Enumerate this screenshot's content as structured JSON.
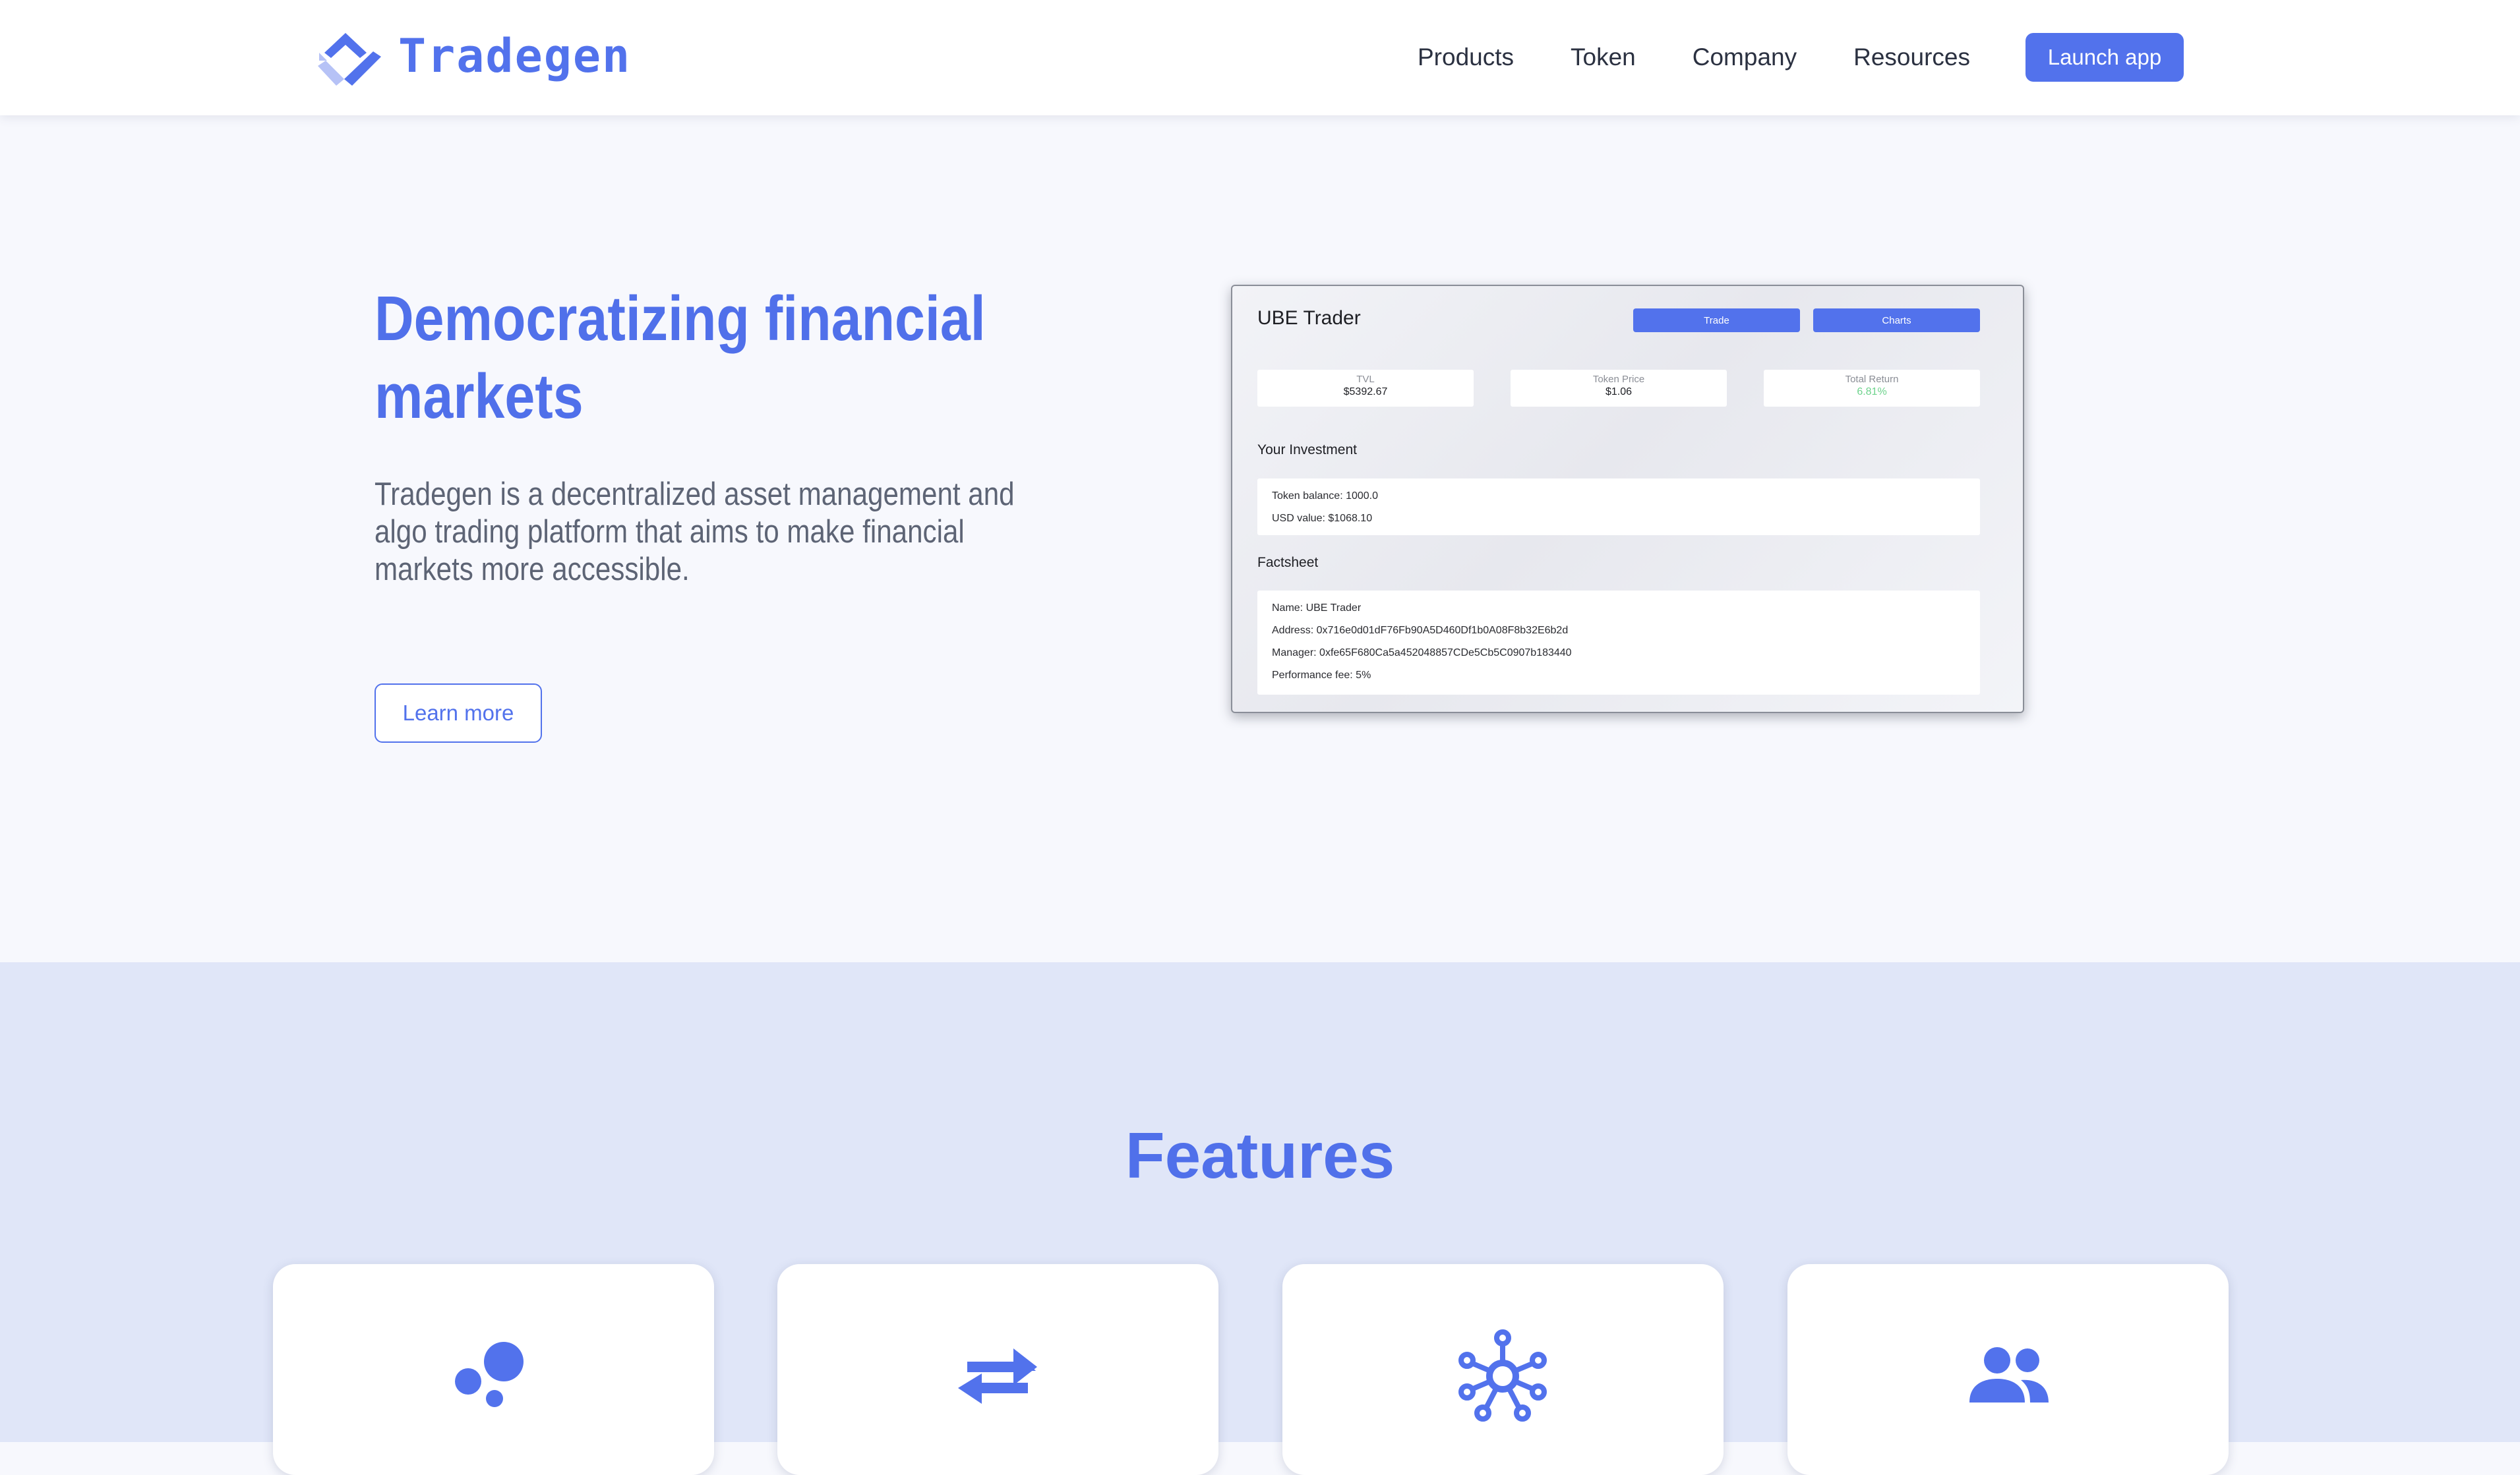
{
  "header": {
    "logo_text": "Tradegen",
    "nav": [
      "Products",
      "Token",
      "Company",
      "Resources"
    ],
    "launch_label": "Launch app"
  },
  "hero": {
    "title_line1": "Democratizing financial",
    "title_line2": "markets",
    "description": "Tradegen is a decentralized asset management and algo trading platform that aims to make financial markets more accessible.",
    "cta_label": "Learn more"
  },
  "app_preview": {
    "title": "UBE Trader",
    "buttons": [
      "Trade",
      "Charts"
    ],
    "stats": [
      {
        "label": "TVL",
        "value": "$5392.67"
      },
      {
        "label": "Token Price",
        "value": "$1.06"
      },
      {
        "label": "Total Return",
        "value": "6.81%"
      }
    ],
    "investment_heading": "Your Investment",
    "investment_lines": [
      "Token balance: 1000.0",
      "USD value: $1068.10"
    ],
    "factsheet_heading": "Factsheet",
    "factsheet_lines": [
      "Name: UBE Trader",
      "Address: 0x716e0d01dF76Fb90A5D460Df1b0A08F8b32E6b2d",
      "Manager: 0xfe65F680Ca5a452048857CDe5Cb5C0907b183440",
      "Performance fee: 5%"
    ]
  },
  "features": {
    "title": "Features",
    "cards": [
      {
        "icon": "bubbles-icon"
      },
      {
        "icon": "swap-arrows-icon"
      },
      {
        "icon": "network-hub-icon"
      },
      {
        "icon": "users-group-icon"
      }
    ]
  },
  "colors": {
    "brand": "#5272ec",
    "positive": "#6dd38c",
    "hero_bg": "#f7f8fd",
    "features_bg": "#e0e6f8"
  }
}
